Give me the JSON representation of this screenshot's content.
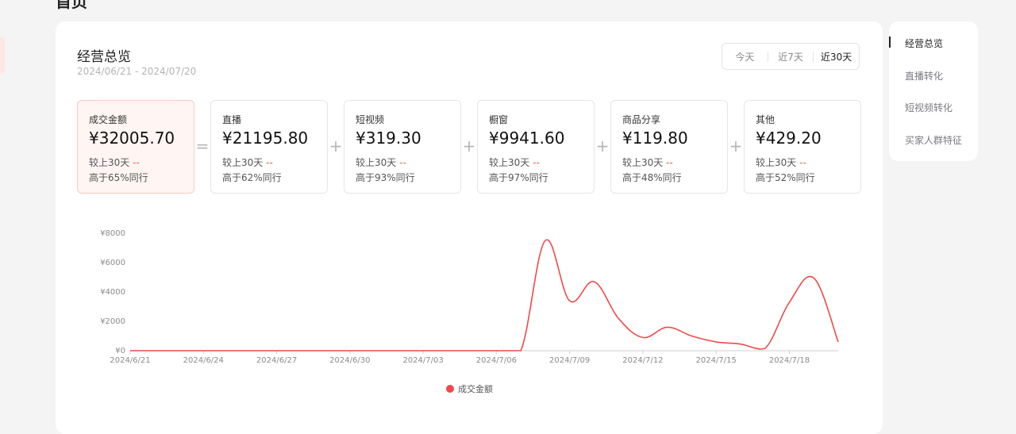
{
  "page": {
    "heading": "首页"
  },
  "overview": {
    "title": "经营总览",
    "date_range": "2024/06/21 - 2024/07/20",
    "periods": [
      "今天",
      "近7天",
      "近30天"
    ],
    "active_period": "近30天"
  },
  "metrics": [
    {
      "label": "成交金额",
      "value": "¥32005.70",
      "compare": "较上30天",
      "compare_value": "--",
      "peer": "高于65%同行"
    },
    {
      "label": "直播",
      "value": "¥21195.80",
      "compare": "较上30天",
      "compare_value": "--",
      "peer": "高于62%同行"
    },
    {
      "label": "短视频",
      "value": "¥319.30",
      "compare": "较上30天",
      "compare_value": "--",
      "peer": "高于93%同行"
    },
    {
      "label": "橱窗",
      "value": "¥9941.60",
      "compare": "较上30天",
      "compare_value": "--",
      "peer": "高于97%同行"
    },
    {
      "label": "商品分享",
      "value": "¥119.80",
      "compare": "较上30天",
      "compare_value": "--",
      "peer": "高于48%同行"
    },
    {
      "label": "其他",
      "value": "¥429.20",
      "compare": "较上30天",
      "compare_value": "--",
      "peer": "高于52%同行"
    }
  ],
  "operators": [
    "=",
    "+",
    "+",
    "+",
    "+"
  ],
  "sidenav": {
    "items": [
      "经营总览",
      "直播转化",
      "短视频转化",
      "买家人群特征"
    ],
    "active": "经营总览"
  },
  "colors": {
    "accent": "#f04a4a",
    "selected_bg": "#fff5f3"
  },
  "chart_data": {
    "type": "line",
    "series": [
      {
        "name": "成交金额",
        "values": [
          0,
          0,
          0,
          0,
          0,
          0,
          0,
          0,
          0,
          0,
          0,
          0,
          0,
          0,
          0,
          0,
          0,
          7500,
          3400,
          4700,
          2200,
          900,
          1600,
          1000,
          600,
          450,
          150,
          3300,
          4950,
          600
        ]
      }
    ],
    "x": [
      "2024/6/21",
      "2024/6/22",
      "2024/6/23",
      "2024/6/24",
      "2024/6/25",
      "2024/6/26",
      "2024/6/27",
      "2024/6/28",
      "2024/6/29",
      "2024/6/30",
      "2024/7/01",
      "2024/7/02",
      "2024/7/03",
      "2024/7/04",
      "2024/7/05",
      "2024/7/06",
      "2024/7/07",
      "2024/7/08",
      "2024/7/09",
      "2024/7/10",
      "2024/7/11",
      "2024/7/12",
      "2024/7/13",
      "2024/7/14",
      "2024/7/15",
      "2024/7/16",
      "2024/7/17",
      "2024/7/18",
      "2024/7/19",
      "2024/7/20"
    ],
    "x_tick_labels": [
      "2024/6/21",
      "2024/6/24",
      "2024/6/27",
      "2024/6/30",
      "2024/7/03",
      "2024/7/06",
      "2024/7/09",
      "2024/7/12",
      "2024/7/15",
      "2024/7/18"
    ],
    "y_tick_labels": [
      "¥0",
      "¥2000",
      "¥4000",
      "¥6000",
      "¥8000"
    ],
    "ylim": [
      0,
      8000
    ],
    "grid": false,
    "legend": "bottom-center"
  }
}
